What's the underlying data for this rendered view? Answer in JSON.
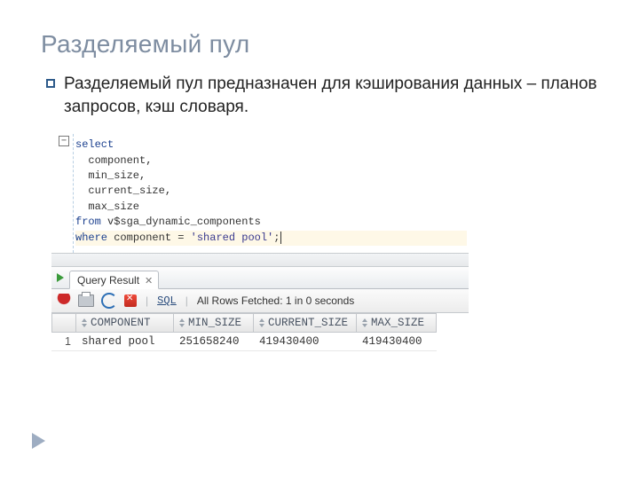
{
  "slide": {
    "title": "Разделяемый пул",
    "bullet": "Разделяемый пул предназначен для кэширования данных – планов запросов, кэш словаря."
  },
  "sql": {
    "lines": [
      {
        "t": "select",
        "kw": true
      },
      {
        "t": "  component,"
      },
      {
        "t": "  min_size,"
      },
      {
        "t": "  current_size,"
      },
      {
        "t": "  max_size"
      },
      {
        "prefix_kw": "from",
        "rest": " v$sga_dynamic_components"
      },
      {
        "prefix_kw": "where",
        "rest": " component = ",
        "str": "'shared pool'",
        "tail": ";",
        "caret": true,
        "highlight": true
      }
    ],
    "fold": "−"
  },
  "results": {
    "tab_label": "Query Result",
    "status": "All Rows Fetched: 1 in 0 seconds",
    "sql_link": "SQL",
    "columns": [
      "COMPONENT",
      "MIN_SIZE",
      "CURRENT_SIZE",
      "MAX_SIZE"
    ],
    "rows": [
      {
        "n": 1,
        "cells": [
          "shared pool",
          "251658240",
          "419430400",
          "419430400"
        ]
      }
    ]
  }
}
